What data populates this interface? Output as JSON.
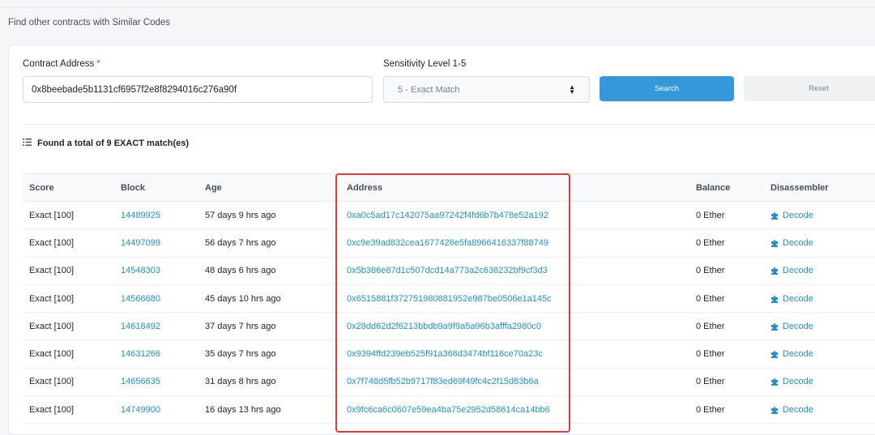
{
  "page": {
    "heading": "Find other contracts with Similar Codes"
  },
  "form": {
    "address_label": "Contract Address",
    "required_mark": "*",
    "address_value": "0x8beebade5b1131cf6957f2e8f8294016c276a90f",
    "sensitivity_label": "Sensitivity Level 1-5",
    "sensitivity_selected": "5 - Exact Match",
    "search_label": "Search",
    "reset_label": "Reset"
  },
  "results": {
    "summary": "Found a total of 9 EXACT match(es)",
    "columns": {
      "score": "Score",
      "block": "Block",
      "age": "Age",
      "address": "Address",
      "balance": "Balance",
      "disassembler": "Disassembler"
    },
    "rows": [
      {
        "score": "Exact [100]",
        "block": "14489925",
        "age": "57 days 9 hrs ago",
        "address": "0xa0c5ad17c142075aa97242f4fd6b7b478e52a192",
        "balance": "0 Ether",
        "action": "Decode"
      },
      {
        "score": "Exact [100]",
        "block": "14497099",
        "age": "56 days 7 hrs ago",
        "address": "0xc9e39ad832cea1677426e5fa8966416337f88749",
        "balance": "0 Ether",
        "action": "Decode"
      },
      {
        "score": "Exact [100]",
        "block": "14548303",
        "age": "48 days 6 hrs ago",
        "address": "0x5b386e87d1c507dcd14a773a2c638232bf9cf3d3",
        "balance": "0 Ether",
        "action": "Decode"
      },
      {
        "score": "Exact [100]",
        "block": "14566680",
        "age": "45 days 10 hrs ago",
        "address": "0x6515881f372751980881952e987be0506e1a145c",
        "balance": "0 Ether",
        "action": "Decode"
      },
      {
        "score": "Exact [100]",
        "block": "14618492",
        "age": "37 days 7 hrs ago",
        "address": "0x28dd62d2f6213bbdb9a9f9a5a96b3afffa2980c0",
        "balance": "0 Ether",
        "action": "Decode"
      },
      {
        "score": "Exact [100]",
        "block": "14631266",
        "age": "35 days 7 hrs ago",
        "address": "0x9394ffd239eb525f91a366d3474bf116ce70a23c",
        "balance": "0 Ether",
        "action": "Decode"
      },
      {
        "score": "Exact [100]",
        "block": "14656635",
        "age": "31 days 8 hrs ago",
        "address": "0x7f748d5fb52b9717f83ed69f49fc4c2f15d83b6a",
        "balance": "0 Ether",
        "action": "Decode"
      },
      {
        "score": "Exact [100]",
        "block": "14749900",
        "age": "16 days 13 hrs ago",
        "address": "0x9fc6ca6c0607e59ea4ba75e2952d58614ca14bb6",
        "balance": "0 Ether",
        "action": "Decode"
      }
    ]
  },
  "icons": {
    "list": "list-icon",
    "select_caret": "sort-caret-icon",
    "decode": "puzzle-icon"
  },
  "colors": {
    "link": "#1e90d6",
    "search_button": "#3498db",
    "highlight_border": "#e53935"
  }
}
